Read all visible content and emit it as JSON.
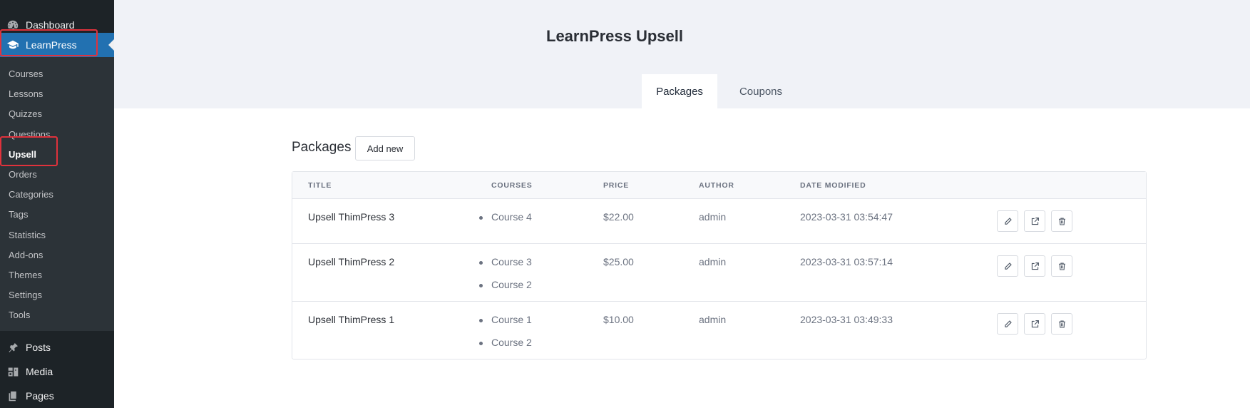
{
  "sidebar": {
    "top_items": [
      {
        "label": "Dashboard",
        "icon": "dashboard-icon"
      },
      {
        "label": "LearnPress",
        "icon": "graduation-cap-icon"
      }
    ],
    "submenu": [
      "Courses",
      "Lessons",
      "Quizzes",
      "Questions",
      "Upsell",
      "Orders",
      "Categories",
      "Tags",
      "Statistics",
      "Add-ons",
      "Themes",
      "Settings",
      "Tools"
    ],
    "active_submenu": "Upsell",
    "lower_items": [
      {
        "label": "Posts",
        "icon": "pin-icon"
      },
      {
        "label": "Media",
        "icon": "media-icon"
      },
      {
        "label": "Pages",
        "icon": "pages-icon"
      }
    ]
  },
  "page": {
    "title": "LearnPress Upsell",
    "tabs": [
      "Packages",
      "Coupons"
    ],
    "active_tab": "Packages",
    "section_heading": "Packages",
    "add_new_label": "Add new"
  },
  "table": {
    "columns": [
      "Title",
      "Courses",
      "Price",
      "Author",
      "Date Modified"
    ],
    "rows": [
      {
        "title": "Upsell ThimPress 3",
        "courses": [
          "Course 4"
        ],
        "price": "$22.00",
        "author": "admin",
        "date": "2023-03-31 03:54:47"
      },
      {
        "title": "Upsell ThimPress 2",
        "courses": [
          "Course 3",
          "Course 2"
        ],
        "price": "$25.00",
        "author": "admin",
        "date": "2023-03-31 03:57:14"
      },
      {
        "title": "Upsell ThimPress 1",
        "courses": [
          "Course 1",
          "Course 2"
        ],
        "price": "$10.00",
        "author": "admin",
        "date": "2023-03-31 03:49:33"
      }
    ],
    "row_actions": [
      "edit-icon",
      "external-link-icon",
      "trash-icon"
    ]
  },
  "colors": {
    "sidebar_bg": "#1d2327",
    "submenu_bg": "#2c3338",
    "accent": "#2271b1",
    "highlight_box": "#e0323c",
    "header_band": "#f0f2f7"
  }
}
